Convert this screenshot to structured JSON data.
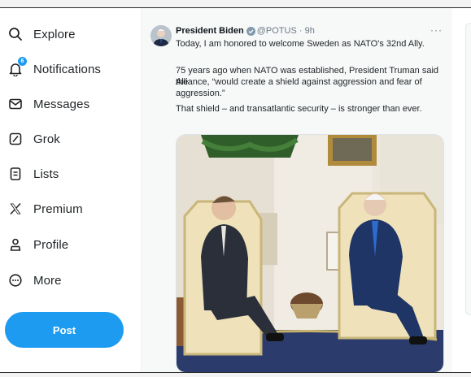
{
  "sidebar": {
    "items": [
      {
        "label": "Explore",
        "icon": "search-icon"
      },
      {
        "label": "Notifications",
        "icon": "bell-icon",
        "badge": "6"
      },
      {
        "label": "Messages",
        "icon": "envelope-icon"
      },
      {
        "label": "Grok",
        "icon": "grok-icon"
      },
      {
        "label": "Lists",
        "icon": "list-icon"
      },
      {
        "label": "Premium",
        "icon": "x-logo-icon"
      },
      {
        "label": "Profile",
        "icon": "person-icon"
      },
      {
        "label": "More",
        "icon": "more-circle-icon"
      }
    ],
    "post_label": "Post"
  },
  "tweet": {
    "author": "President Biden",
    "handle": "@POTUS · 9h",
    "more": "···",
    "text_1": "Today, I am honored to welcome Sweden as NATO's 32nd Ally.",
    "text_2a": "75 years ago when NATO was established, President Truman said the",
    "text_2b": "Alliance, “would create a shield against aggression and fear of aggression.”",
    "text_3": "That shield – and transatlantic security – is stronger than ever."
  },
  "colors": {
    "accent": "#1d9bf0",
    "text": "#0f1419",
    "muted": "#6b7785"
  }
}
